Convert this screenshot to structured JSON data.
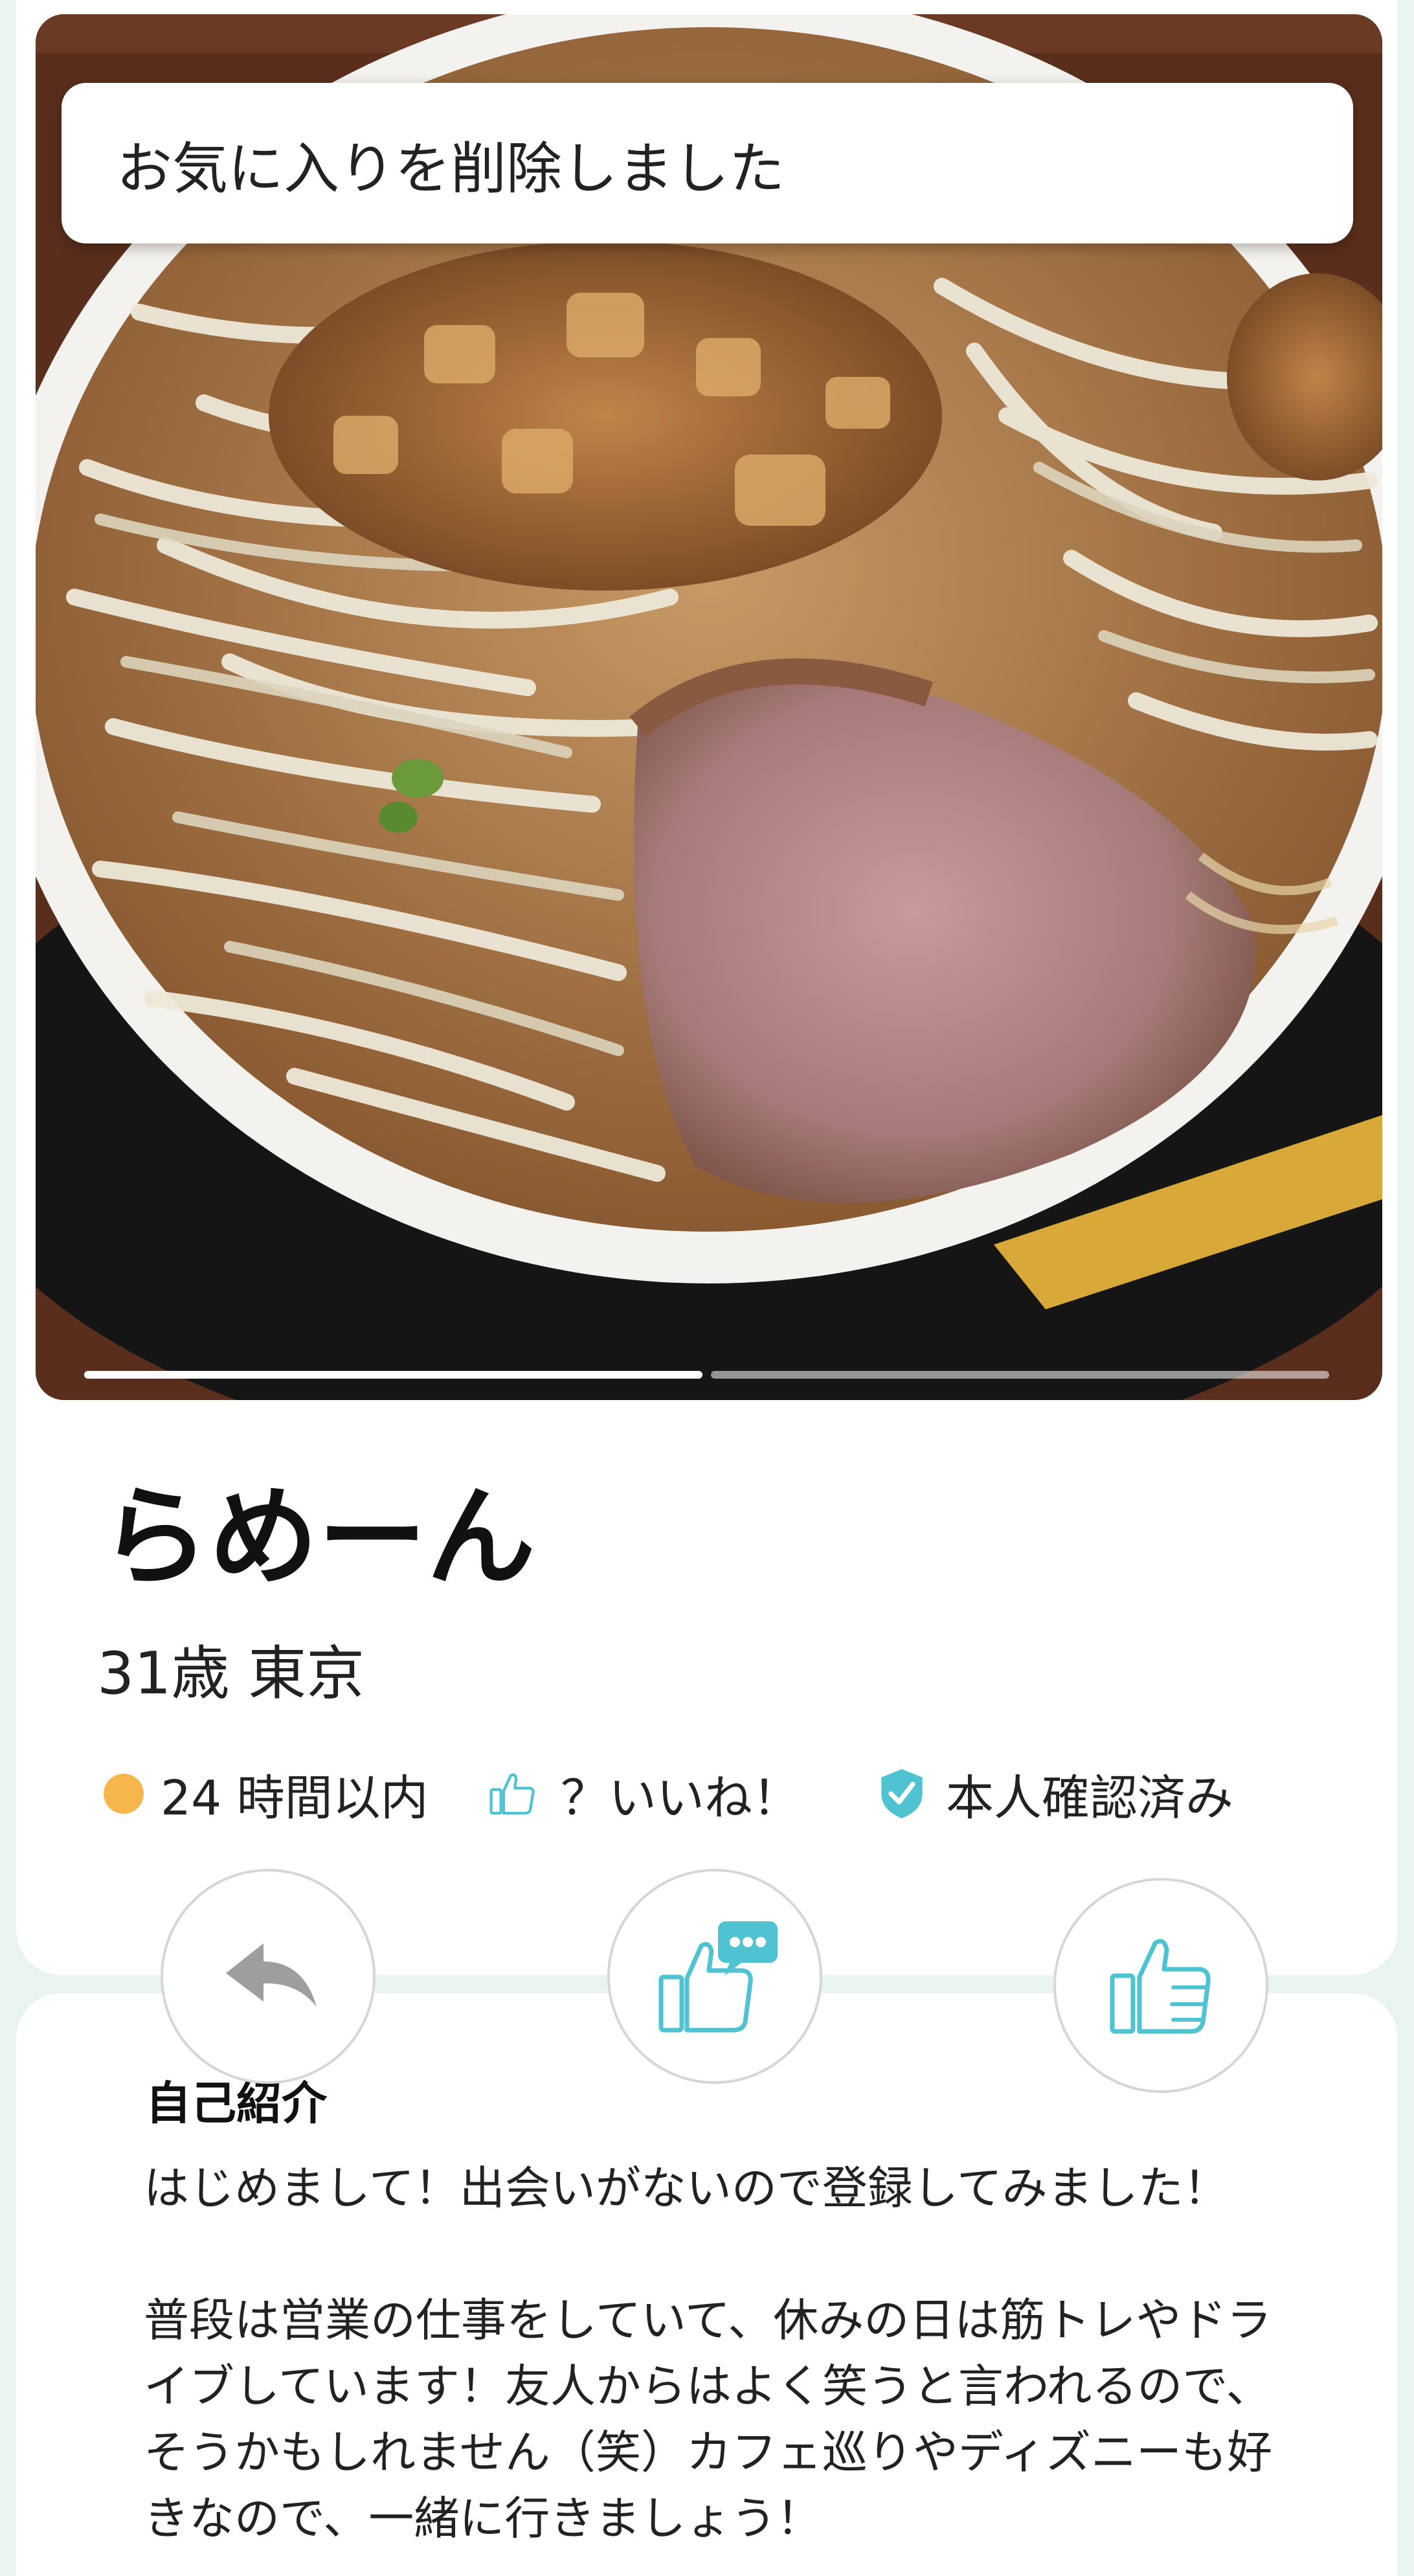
{
  "toast": {
    "message": "お気に入りを削除しました"
  },
  "photo": {
    "description_icon": "ramen-photo",
    "page_count": 2,
    "current_page": 1
  },
  "profile": {
    "name": "らめーん",
    "age_location": "31歳 東京",
    "stats": {
      "activity": "24 時間以内",
      "likes": "？いいね！",
      "verified": "本人確認済み"
    }
  },
  "actions": {
    "back_icon": "back-arrow-icon",
    "message_like_icon": "message-like-icon",
    "like_icon": "thumbs-up-icon"
  },
  "intro": {
    "title": "自己紹介",
    "body": "はじめまして！出会いがないので登録してみました！\n\n普段は営業の仕事をしていて、休みの日は筋トレやドライブしています！友人からはよく笑うと言われるので、そうかもしれません（笑）カフェ巡りやディズニーも好きなので、一緒に行きましょう！"
  },
  "colors": {
    "accent": "#4fc3d1",
    "activity_dot": "#f7b64b",
    "background": "#e9f3f2"
  }
}
